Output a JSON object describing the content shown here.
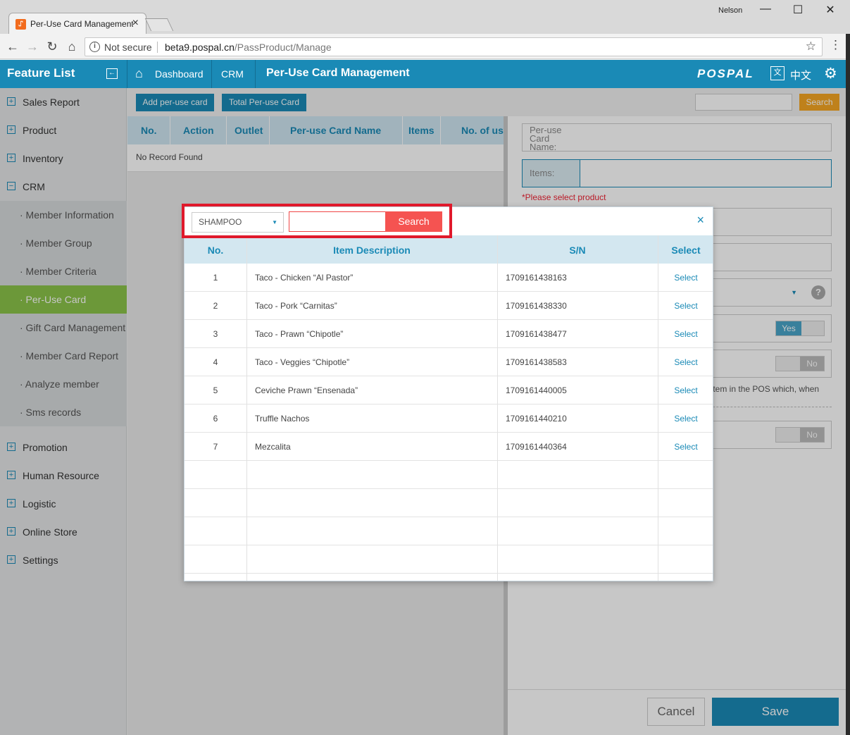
{
  "browser": {
    "tab_title": "Per-Use Card Management",
    "favicon_glyph": "⑀",
    "user": "Nelson",
    "security_text": "Not secure",
    "url_host": "beta9.pospal.cn",
    "url_path": "/PassProduct/Manage"
  },
  "header": {
    "feature_list": "Feature List",
    "breadcrumb": [
      "Dashboard",
      "CRM",
      "Per-Use Card Management"
    ],
    "logo": "POSPAL",
    "lang_icon": "文",
    "lang": "中文"
  },
  "sidebar": {
    "items": [
      {
        "label": "Sales Report",
        "icon": "plus-icon"
      },
      {
        "label": "Product",
        "icon": "plus-icon"
      },
      {
        "label": "Inventory",
        "icon": "plus-icon"
      },
      {
        "label": "CRM",
        "icon": "minus-icon"
      }
    ],
    "crm_subitems": [
      "· Member Information",
      "· Member Group",
      "· Member Criteria",
      "· Per-Use Card",
      "· Gift Card Management",
      "· Member Card Report",
      "· Analyze member",
      "· Sms records"
    ],
    "bottom_items": [
      "Promotion",
      "Human Resource",
      "Logistic",
      "Online Store",
      "Settings"
    ]
  },
  "toolbar": {
    "add_label": "Add per-use card",
    "total_label": "Total Per-use Card",
    "search_label": "Search"
  },
  "list": {
    "columns": [
      "No.",
      "Action",
      "Outlet",
      "Per-use Card Name",
      "Items",
      "No. of usa"
    ],
    "empty": "No Record Found"
  },
  "form": {
    "name_label": "Per-use Card Name:",
    "items_label": "Items:",
    "error": "*Please select product",
    "toggle_yes": "Yes",
    "toggle_no": "No",
    "help": "?",
    "hint": "an item in the POS which, when",
    "cancel": "Cancel",
    "save": "Save"
  },
  "modal": {
    "category": "SHAMPOO",
    "search_value": "",
    "search_label": "Search",
    "close": "×",
    "columns": [
      "No.",
      "Item Description",
      "S/N",
      "Select"
    ],
    "rows": [
      {
        "no": "1",
        "desc": "Taco - Chicken “Al Pastor”",
        "sn": "1709161438163",
        "select": "Select"
      },
      {
        "no": "2",
        "desc": "Taco - Pork “Carnitas”",
        "sn": "1709161438330",
        "select": "Select"
      },
      {
        "no": "3",
        "desc": "Taco - Prawn “Chipotle”",
        "sn": "1709161438477",
        "select": "Select"
      },
      {
        "no": "4",
        "desc": "Taco - Veggies “Chipotle”",
        "sn": "1709161438583",
        "select": "Select"
      },
      {
        "no": "5",
        "desc": "Ceviche Prawn “Ensenada”",
        "sn": "1709161440005",
        "select": "Select"
      },
      {
        "no": "6",
        "desc": "Truffle Nachos",
        "sn": "1709161440210",
        "select": "Select"
      },
      {
        "no": "7",
        "desc": "Mezcalita",
        "sn": "1709161440364",
        "select": "Select"
      }
    ]
  },
  "colors": {
    "primary": "#1a8ab6",
    "active_green": "#8bc34a",
    "search_orange": "#f5a623",
    "search_red": "#f55351",
    "highlight_red": "#e0192b"
  }
}
